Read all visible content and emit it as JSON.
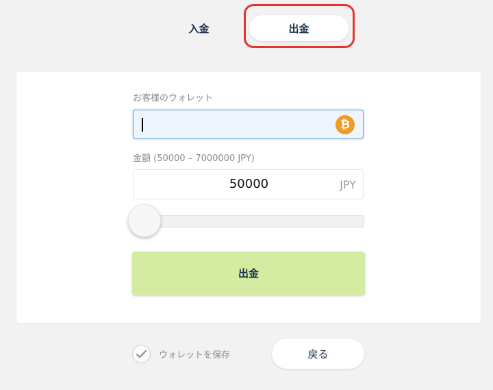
{
  "tabs": {
    "deposit": "入金",
    "withdraw": "出金",
    "active": "withdraw"
  },
  "form": {
    "wallet_label": "お客様のウォレット",
    "wallet_value": "",
    "wallet_icon": "bitcoin-icon",
    "amount_label": "金額 (50000 – 7000000 JPY)",
    "amount_value": "50000",
    "amount_unit": "JPY",
    "slider_value": 50000,
    "slider_min": 50000,
    "slider_max": 7000000,
    "submit_label": "出金"
  },
  "footer": {
    "save_wallet_label": "ウォレットを保存",
    "save_wallet_checked": true,
    "back_label": "戻る"
  },
  "colors": {
    "accent_submit": "#d3eca1",
    "highlight_border": "#e8322e",
    "bitcoin": "#f09a2a",
    "text_dark": "#1a2e4a"
  }
}
